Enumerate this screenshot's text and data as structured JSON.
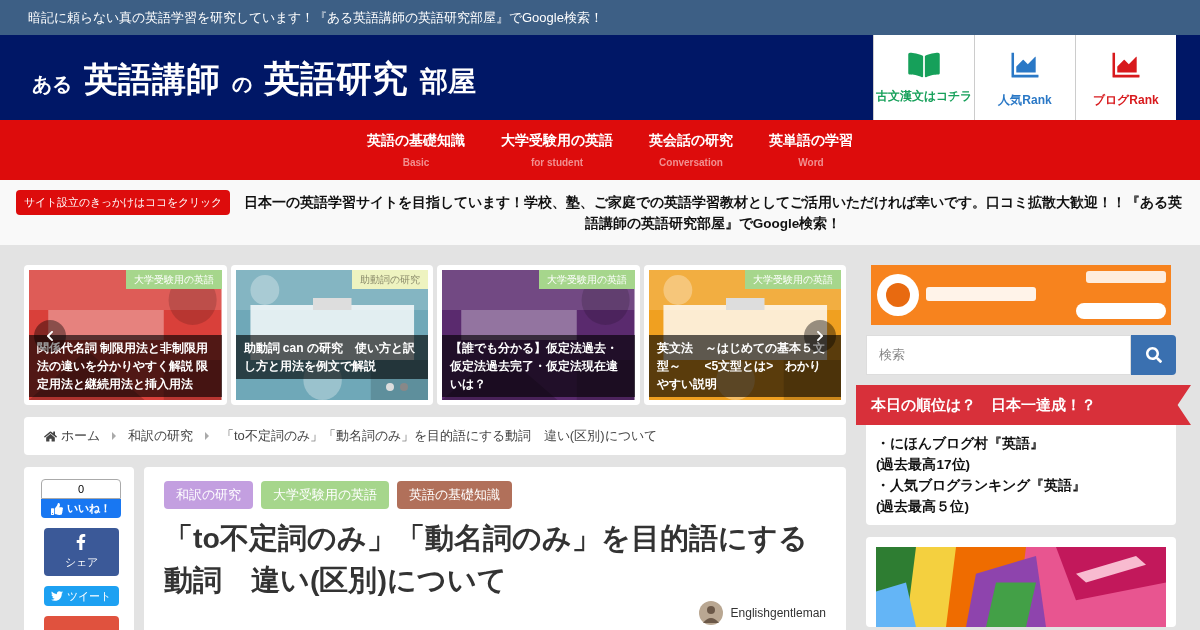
{
  "top_bar": {
    "text": "暗記に頼らない真の英語学習を研究しています！『ある英語講師の英語研究部屋』でGoogle検索！"
  },
  "logo": {
    "parts": [
      {
        "text": "ある",
        "kind": "small"
      },
      {
        "text": "英語講師",
        "kind": "bold"
      },
      {
        "text": "の",
        "kind": "small"
      },
      {
        "text": "英語研究",
        "kind": "brush"
      },
      {
        "text": "部屋",
        "kind": "brushsmall"
      }
    ]
  },
  "header_links": [
    {
      "label": "古文漢文はコチラ",
      "kind": "book",
      "color": "#16a05a"
    },
    {
      "label": "人気Rank",
      "kind": "chart",
      "color": "#2a78c6"
    },
    {
      "label": "ブログRank",
      "kind": "chart",
      "color": "#d8191c"
    }
  ],
  "nav": [
    {
      "label": "英語の基礎知識",
      "sub": "Basic"
    },
    {
      "label": "大学受験用の英語",
      "sub": "for student"
    },
    {
      "label": "英会話の研究",
      "sub": "Conversation"
    },
    {
      "label": "英単語の学習",
      "sub": "Word"
    }
  ],
  "notice": {
    "button": "サイト設立のきっかけはココをクリック",
    "text": "日本一の英語学習サイトを目指しています！学校、塾、ご家庭での英語学習教材としてご活用いただければ幸いです。口コミ拡散大歓迎！！『ある英語講師の英語研究部屋』でGoogle検索！"
  },
  "slider": {
    "cards": [
      {
        "category": "大学受験用の英語",
        "caption": "関係代名詞 制限用法と非制限用法の違いを分かりやすく解説 限定用法と継続用法と挿入用法",
        "faded": false
      },
      {
        "category": "助動詞の研究",
        "caption": "助動詞 can の研究　使い方と訳し方と用法を例文で解説",
        "faded": true
      },
      {
        "category": "大学受験用の英語",
        "caption": "【誰でも分かる】仮定法過去・仮定法過去完了・仮定法現在違いは？",
        "faded": false
      },
      {
        "category": "大学受験用の英語",
        "caption": "英文法　～はじめての基本５文型～　　<5文型とは>　わかりやすい説明",
        "faded": false
      }
    ],
    "dots": [
      {
        "selected": true
      },
      {
        "selected": false
      }
    ]
  },
  "breadcrumb": [
    {
      "label": "ホーム",
      "home": true
    },
    {
      "label": "和訳の研究",
      "home": false
    },
    {
      "label": "「to不定詞のみ」「動名詞のみ」を目的語にする動詞　違い(区別)について",
      "home": false
    }
  ],
  "share": {
    "like_count": "0",
    "like": "いいね！",
    "share": "シェア",
    "tweet": "ツイート"
  },
  "article": {
    "tags": [
      {
        "label": "和訳の研究",
        "color": "#c39fe0"
      },
      {
        "label": "大学受験用の英語",
        "color": "#a6d68c"
      },
      {
        "label": "英語の基礎知識",
        "color": "#b1705a"
      }
    ],
    "title": "「to不定詞のみ」「動名詞のみ」を目的語にする動詞　違い(区別)について",
    "author": "Englishgentleman"
  },
  "sidebar": {
    "search_placeholder": "検索",
    "ranking": {
      "title": "本日の順位は？　日本一達成！？",
      "lines": [
        "・にほんブログ村『英語』",
        "(過去最高17位)",
        "・人気ブログランキング『英語』",
        "(過去最高５位)"
      ]
    }
  }
}
